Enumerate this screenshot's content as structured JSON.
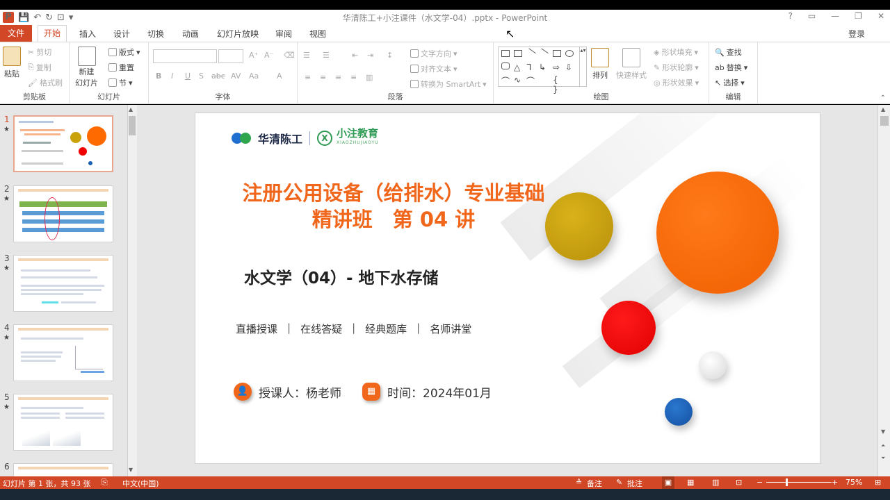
{
  "app": {
    "window_title": "华清陈工+小注课件（水文学-04）.pptx - PowerPoint",
    "login": "登录",
    "help": "?",
    "minimize": "—",
    "close": "✕"
  },
  "tabs": [
    "文件",
    "开始",
    "插入",
    "设计",
    "切换",
    "动画",
    "幻灯片放映",
    "审阅",
    "视图"
  ],
  "ribbon": {
    "clipboard": {
      "paste": "粘贴",
      "cut": "剪切",
      "copy": "复制",
      "format_painter": "格式刷",
      "label": "剪贴板"
    },
    "slides": {
      "new_slide": "新建",
      "new_slide2": "幻灯片",
      "layout": "版式",
      "reset": "重置",
      "section": "节",
      "label": "幻灯片"
    },
    "font": {
      "label": "字体",
      "bold": "B",
      "italic": "I",
      "underline": "U",
      "shadow": "S",
      "strike": "abc",
      "spacing": "AV",
      "case": "Aa",
      "color": "A"
    },
    "paragraph": {
      "text_direction": "文字方向",
      "align_text": "对齐文本",
      "smartart": "转换为 SmartArt",
      "label": "段落"
    },
    "drawing": {
      "arrange": "排列",
      "quick_styles": "快速样式",
      "shape_fill": "形状填充",
      "shape_outline": "形状轮廓",
      "shape_effects": "形状效果",
      "label": "绘图"
    },
    "editing": {
      "find": "查找",
      "replace": "替换",
      "select": "选择",
      "label": "编辑"
    }
  },
  "thumbnails": [
    {
      "num": "1",
      "star": "★"
    },
    {
      "num": "2",
      "star": "★"
    },
    {
      "num": "3",
      "star": "★"
    },
    {
      "num": "4",
      "star": "★"
    },
    {
      "num": "5",
      "star": "★"
    },
    {
      "num": "6",
      "star": ""
    }
  ],
  "slide": {
    "logo_brand": "华清陈工",
    "logo_brand2": "小注教育",
    "logo_brand2_pinyin": "XIAOZHUJIAOYU",
    "title_line1": "注册公用设备（给排水）专业基础",
    "title_line2": "精讲班　第 04 讲",
    "subtitle": "水文学（04）- 地下水存储",
    "features": [
      "直播授课",
      "在线答疑",
      "经典题库",
      "名师讲堂"
    ],
    "feature_sep": "|",
    "instructor": "授课人：杨老师",
    "time": "时间：2024年01月"
  },
  "colors": {
    "accent": "#d24726",
    "title_orange": "#f0661b",
    "ball_gold": "#c9a20a",
    "ball_orange": "#ff6a00",
    "ball_red": "#f20000",
    "ball_blue": "#1a5fb4",
    "ball_white": "#eeeeee"
  },
  "status": {
    "slide_info": "幻灯片 第 1 张，共 93 张",
    "language": "中文(中国)",
    "notes": "备注",
    "comments": "批注",
    "zoom": "75%"
  }
}
